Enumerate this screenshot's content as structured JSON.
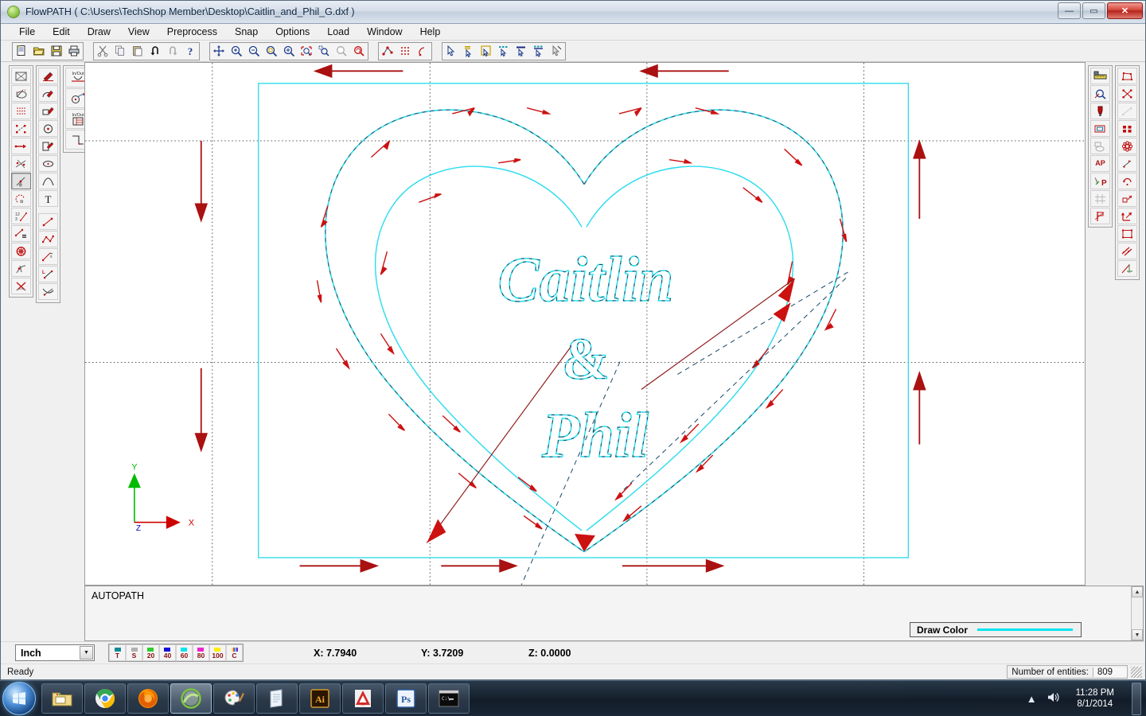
{
  "window": {
    "title": "FlowPATH ( C:\\Users\\TechShop Member\\Desktop\\Caitlin_and_Phil_G.dxf )",
    "app_icon": "flowpath-orb-icon",
    "minimize_label": "—",
    "maximize_label": "▭",
    "close_label": "✕"
  },
  "menu": {
    "items": [
      {
        "label": "File"
      },
      {
        "label": "Edit"
      },
      {
        "label": "Draw"
      },
      {
        "label": "View"
      },
      {
        "label": "Preprocess"
      },
      {
        "label": "Snap"
      },
      {
        "label": "Options"
      },
      {
        "label": "Load"
      },
      {
        "label": "Window"
      },
      {
        "label": "Help"
      }
    ]
  },
  "toolbar": {
    "groups": [
      {
        "name": "file-group",
        "buttons": [
          {
            "icon": "new-document-icon",
            "label": "New"
          },
          {
            "icon": "open-folder-icon",
            "label": "Open"
          },
          {
            "icon": "save-disk-icon",
            "label": "Save"
          },
          {
            "icon": "print-icon",
            "label": "Print"
          }
        ]
      },
      {
        "name": "edit-group",
        "buttons": [
          {
            "icon": "cut-scissors-icon",
            "label": "Cut"
          },
          {
            "icon": "copy-icon",
            "label": "Copy"
          },
          {
            "icon": "paste-icon",
            "label": "Paste"
          },
          {
            "icon": "undo-icon",
            "label": "Undo"
          },
          {
            "icon": "redo-icon",
            "label": "Redo"
          },
          {
            "icon": "help-question-icon",
            "label": "Help"
          }
        ]
      },
      {
        "name": "view-group",
        "buttons": [
          {
            "icon": "pan-move-icon",
            "label": "Pan"
          },
          {
            "icon": "zoom-in-icon",
            "label": "Zoom In"
          },
          {
            "icon": "zoom-out-icon",
            "label": "Zoom Out"
          },
          {
            "icon": "zoom-window-icon",
            "label": "Zoom Window"
          },
          {
            "icon": "zoom-extents-icon",
            "label": "Zoom Extents"
          },
          {
            "icon": "zoom-all-icon",
            "label": "Zoom All"
          },
          {
            "icon": "zoom-previous-icon",
            "label": "Zoom Previous"
          },
          {
            "icon": "redraw-icon",
            "label": "Redraw"
          },
          {
            "icon": "regen-icon",
            "label": "Regen"
          }
        ]
      },
      {
        "name": "snap-group",
        "buttons": [
          {
            "icon": "node-snap-icon",
            "label": "Node Snap"
          },
          {
            "icon": "grid-snap-icon",
            "label": "Grid Snap"
          },
          {
            "icon": "path-snap-icon",
            "label": "Path Snap"
          }
        ]
      },
      {
        "name": "select-group",
        "buttons": [
          {
            "icon": "select-arrow-icon",
            "label": "Select"
          },
          {
            "icon": "select-top-icon",
            "label": "Select Top"
          },
          {
            "icon": "select-box-icon",
            "label": "Select Box"
          },
          {
            "icon": "select-dashed-top-icon",
            "label": "Select Dashed"
          },
          {
            "icon": "select-line-icon",
            "label": "Select Line"
          },
          {
            "icon": "select-dashed-bar-icon",
            "label": "Select Bar"
          },
          {
            "icon": "deselect-icon",
            "label": "Deselect"
          }
        ]
      }
    ]
  },
  "left_palette": {
    "columns": [
      {
        "name": "entity-column",
        "buttons": [
          {
            "icon": "boundary-box-icon"
          },
          {
            "icon": "coordinate-system-icon"
          },
          {
            "icon": "point-grid-icon"
          },
          {
            "icon": "polyline-nodes-icon"
          },
          {
            "icon": "vector-direction-icon"
          },
          {
            "icon": "intersect-nodes-icon"
          },
          {
            "icon": "tangent-line-icon",
            "state": "active"
          },
          {
            "icon": "arc-node-icon"
          },
          {
            "icon": "fraction-divide-icon"
          },
          {
            "icon": "offset-list-icon"
          },
          {
            "icon": "rotate-wheel-icon"
          },
          {
            "icon": "trim-branch-icon"
          },
          {
            "icon": "delete-cross-icon"
          }
        ]
      },
      {
        "name": "draw-column",
        "buttons": [
          {
            "icon": "pen-line-icon"
          },
          {
            "icon": "pen-arc-icon"
          },
          {
            "icon": "pen-rect-icon"
          },
          {
            "icon": "circle-center-icon"
          },
          {
            "icon": "pen-polygon-icon"
          },
          {
            "icon": "ellipse-icon"
          },
          {
            "icon": "spline-curve-icon"
          },
          {
            "icon": "text-tool-icon"
          },
          {
            "icon": "line-two-point-icon"
          },
          {
            "icon": "polyline-chain-icon"
          },
          {
            "icon": "line-offset-icon"
          },
          {
            "icon": "line-length-icon"
          },
          {
            "icon": "curve-cross-icon"
          }
        ]
      },
      {
        "name": "leadinout-column",
        "buttons": [
          {
            "icon": "leadin-arc-icon",
            "label": "In/Out"
          },
          {
            "icon": "leadin-loop-icon"
          },
          {
            "icon": "leadin-table-icon",
            "label": "In/Out"
          },
          {
            "icon": "leadin-corner-icon"
          }
        ]
      }
    ]
  },
  "right_palette": {
    "columns": [
      {
        "name": "measure-column",
        "buttons": [
          {
            "icon": "ruler-measure-icon"
          },
          {
            "icon": "inspect-magnifier-icon"
          },
          {
            "icon": "nozzle-tool-icon"
          },
          {
            "icon": "boundary-offset-icon"
          },
          {
            "icon": "shape-merge-icon"
          },
          {
            "icon": "autopath-ap-icon",
            "label": "AP"
          },
          {
            "icon": "path-pen-icon",
            "label": "P"
          },
          {
            "icon": "grid-align-icon"
          },
          {
            "icon": "pierce-flag-icon"
          }
        ]
      },
      {
        "name": "transform-column",
        "buttons": [
          {
            "icon": "polygon-nodes-icon"
          },
          {
            "icon": "explode-nodes-icon"
          },
          {
            "icon": "connect-nodes-icon"
          },
          {
            "icon": "array-grid-icon"
          },
          {
            "icon": "circular-array-icon"
          },
          {
            "icon": "mirror-line-icon"
          },
          {
            "icon": "rotate-path-icon"
          },
          {
            "icon": "scale-arrow-icon"
          },
          {
            "icon": "move-arrows-icon"
          },
          {
            "icon": "bounding-resize-icon"
          },
          {
            "icon": "parallel-offset-icon"
          },
          {
            "icon": "chamfer-angle-icon"
          }
        ]
      }
    ]
  },
  "canvas": {
    "drawing_name": "heart-with-names-drawing",
    "geometry_color": "#29dcee",
    "arrow_color": "#cc1111",
    "lead_line_color": "#1a4a6a",
    "axis": {
      "x_label": "X",
      "y_label": "Y",
      "z_label": "Z",
      "x_color": "#cc0000",
      "y_color": "#00bb00",
      "z_color": "#0000bb"
    },
    "artwork_text": {
      "line1": "Caitlin",
      "line2": "&",
      "line3": "Phil"
    }
  },
  "log": {
    "message": "AUTOPATH",
    "scroll_up": "▲",
    "scroll_down": "▼"
  },
  "draw_color": {
    "label": "Draw Color",
    "swatch": "#00e5f0"
  },
  "status": {
    "unit": "Inch",
    "unit_arrow": "▼",
    "color_buttons": [
      {
        "label": "T",
        "chip": "#108a96"
      },
      {
        "label": "S",
        "chip": "#b0b0b0"
      },
      {
        "label": "20",
        "chip": "#2ecc2e"
      },
      {
        "label": "40",
        "chip": "#1111dd"
      },
      {
        "label": "60",
        "chip": "#00e5f0"
      },
      {
        "label": "80",
        "chip": "#ee22cc"
      },
      {
        "label": "100",
        "chip": "#ffee00"
      },
      {
        "label": "C",
        "chip": "#8822cc"
      }
    ],
    "coord_x": "X:  7.7940",
    "coord_y": "Y:  3.7209",
    "coord_z": "Z:  0.0000",
    "ready": "Ready",
    "entities_label": "Number of entities:",
    "entities_value": "809"
  },
  "taskbar": {
    "start_label": "start-orb-icon",
    "items": [
      {
        "icon": "windows-explorer-icon",
        "name": "explorer"
      },
      {
        "icon": "google-chrome-icon",
        "name": "chrome"
      },
      {
        "icon": "firefox-icon",
        "name": "firefox"
      },
      {
        "icon": "flowpath-icon",
        "name": "flowpath",
        "state": "active"
      },
      {
        "icon": "paint-palette-icon",
        "name": "paint"
      },
      {
        "icon": "notepad-icon",
        "name": "notepad"
      },
      {
        "icon": "illustrator-icon",
        "name": "illustrator",
        "label": "Ai"
      },
      {
        "icon": "autocad-icon",
        "name": "autocad"
      },
      {
        "icon": "photoshop-icon",
        "name": "photoshop",
        "label": "Ps"
      },
      {
        "icon": "command-prompt-icon",
        "name": "cmd",
        "label": "C:\\"
      }
    ],
    "tray": {
      "show_hidden": "▲",
      "volume": "volume-icon",
      "time": "11:28 PM",
      "date": "8/1/2014"
    }
  }
}
